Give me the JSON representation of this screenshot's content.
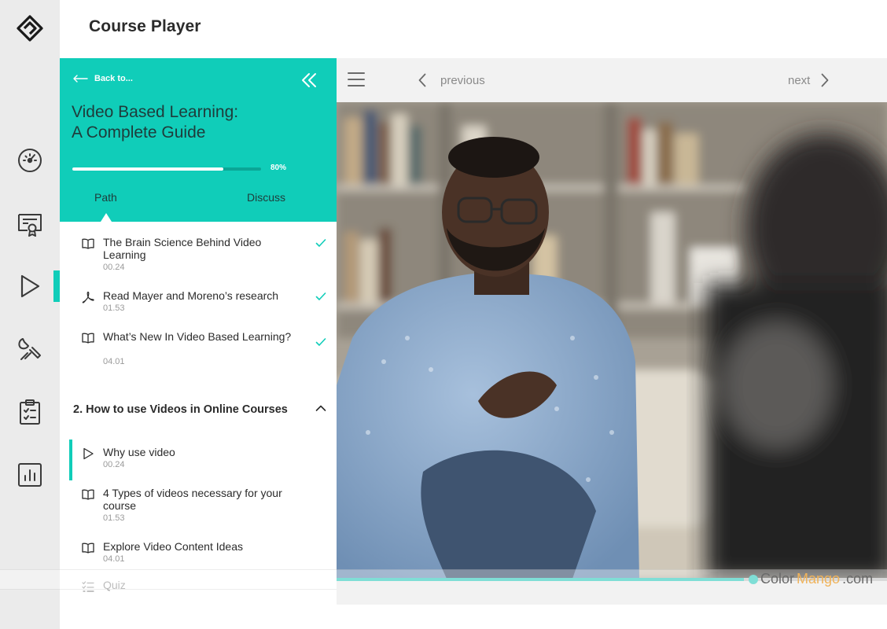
{
  "app": {
    "title": "Course Player"
  },
  "rail": {
    "items": [
      {
        "name": "dashboard-icon",
        "active": false
      },
      {
        "name": "certificate-icon",
        "active": false
      },
      {
        "name": "play-icon",
        "active": true
      },
      {
        "name": "tools-icon",
        "active": false
      },
      {
        "name": "clipboard-icon",
        "active": false
      },
      {
        "name": "chart-icon",
        "active": false
      }
    ]
  },
  "course": {
    "back_label": "Back to...",
    "title": "Video Based Learning:\nA Complete Guide",
    "progress": 0.8,
    "progress_label": "80%",
    "tabs": {
      "path": "Path",
      "discuss": "Discuss",
      "active": "Path"
    }
  },
  "lessons": [
    {
      "title": "The Brain Science Behind Video Learning",
      "duration": "00.24",
      "icon": "book-icon",
      "completed": true
    },
    {
      "title": "Read Mayer and Moreno’s research",
      "duration": "01.53",
      "icon": "pdf-icon",
      "completed": true
    },
    {
      "title": "What’s New In Video Based Learning?",
      "duration": "04.01",
      "icon": "book-icon",
      "completed": true
    }
  ],
  "section": {
    "title": "2. How to use Videos in Online Courses",
    "expanded": true
  },
  "section_lessons": [
    {
      "title": "Why use video",
      "duration": "00.24",
      "icon": "play-icon",
      "current": true
    },
    {
      "title": "4 Types of videos necessary for your course",
      "duration": "01.53",
      "icon": "book-icon"
    },
    {
      "title": "Explore Video Content Ideas",
      "duration": "04.01",
      "icon": "book-icon"
    }
  ],
  "quiz": {
    "label": "Quiz",
    "icon": "checklist-icon"
  },
  "player": {
    "previous_label": "previous",
    "next_label": "next",
    "playback_progress": 0.74
  },
  "watermark": {
    "part1": "Color",
    "part2": "Mango",
    "part3": ".com"
  },
  "colors": {
    "accent": "#10cdb9",
    "rail_bg": "#ebebeb",
    "bar_bg": "#f2f2f2"
  }
}
